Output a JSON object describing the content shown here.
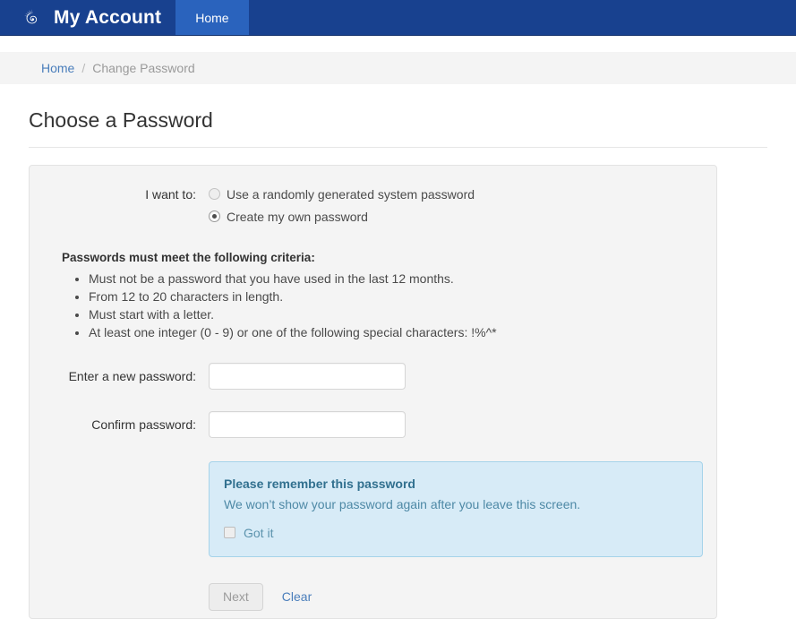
{
  "navbar": {
    "logo_icon": "nautilus-shell-logo",
    "brand_title": "My Account",
    "tabs": [
      {
        "label": "Home",
        "active": true
      }
    ],
    "background_color": "#18418f",
    "active_tab_color": "#2a63bd"
  },
  "breadcrumb": {
    "home_label": "Home",
    "separator": "/",
    "current_label": "Change Password"
  },
  "page": {
    "title": "Choose a Password"
  },
  "form": {
    "want_to_label": "I want to:",
    "options": [
      {
        "label": "Use a randomly generated system password",
        "selected": false
      },
      {
        "label": "Create my own password",
        "selected": true
      }
    ],
    "criteria_heading": "Passwords must meet the following criteria:",
    "criteria": [
      "Must not be a password that you have used in the last 12 months.",
      "From 12 to 20 characters in length.",
      "Must start with a letter.",
      "At least one integer (0 - 9) or one of the following special characters: !%^*"
    ],
    "new_password": {
      "label": "Enter a new password:",
      "value": "",
      "placeholder": ""
    },
    "confirm_password": {
      "label": "Confirm password:",
      "value": "",
      "placeholder": ""
    }
  },
  "alert": {
    "title": "Please remember this password",
    "message": "We won’t show your password again after you leave this screen.",
    "checkbox_label": "Got it",
    "checkbox_checked": false,
    "background_color": "#d7ebf7",
    "border_color": "#a6d3ea",
    "title_color": "#31708f"
  },
  "actions": {
    "next_label": "Next",
    "next_disabled": true,
    "clear_label": "Clear",
    "link_color": "#4a7ebb"
  }
}
